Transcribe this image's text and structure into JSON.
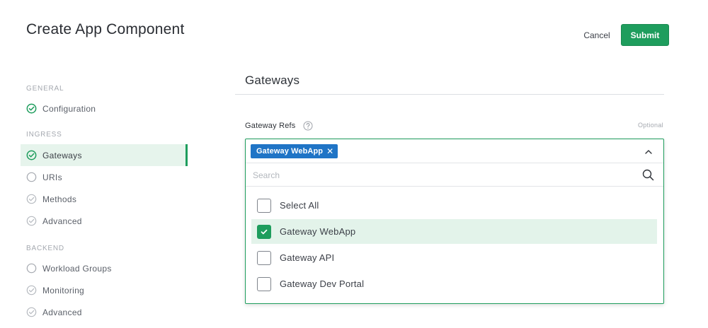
{
  "header": {
    "title": "Create App Component",
    "cancel_label": "Cancel",
    "submit_label": "Submit"
  },
  "sidebar": {
    "sections": [
      {
        "heading": "GENERAL",
        "items": [
          {
            "label": "Configuration",
            "status": "complete"
          }
        ]
      },
      {
        "heading": "INGRESS",
        "items": [
          {
            "label": "Gateways",
            "status": "complete",
            "active": true
          },
          {
            "label": "URIs",
            "status": "empty"
          },
          {
            "label": "Methods",
            "status": "complete-muted"
          },
          {
            "label": "Advanced",
            "status": "complete-muted"
          }
        ]
      },
      {
        "heading": "BACKEND",
        "items": [
          {
            "label": "Workload Groups",
            "status": "empty"
          },
          {
            "label": "Monitoring",
            "status": "complete-muted"
          },
          {
            "label": "Advanced",
            "status": "complete-muted"
          }
        ]
      }
    ]
  },
  "main": {
    "section_title": "Gateways",
    "field_label": "Gateway Refs",
    "optional_label": "Optional",
    "selected_chip": "Gateway WebApp",
    "search_placeholder": "Search",
    "options": [
      {
        "label": "Select All",
        "checked": false
      },
      {
        "label": "Gateway WebApp",
        "checked": true
      },
      {
        "label": "Gateway API",
        "checked": false
      },
      {
        "label": "Gateway Dev Portal",
        "checked": false
      }
    ]
  },
  "colors": {
    "accent": "#1e9d5d",
    "chip": "#1f74c6",
    "active_bg": "#e6f4ec"
  }
}
